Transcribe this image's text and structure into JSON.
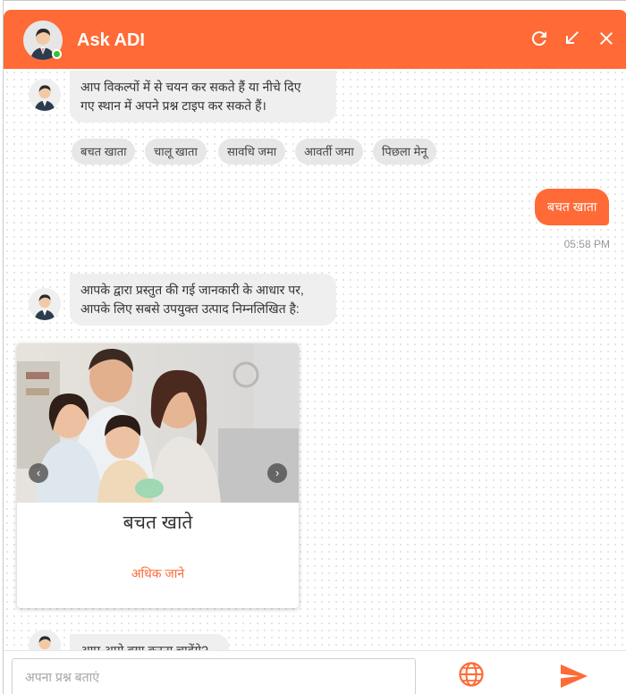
{
  "header": {
    "title": "Ask ADI",
    "icons": [
      "bot-avatar",
      "refresh-icon",
      "minimize-icon",
      "close-icon"
    ]
  },
  "messages": {
    "bot_intro": {
      "line1": "आप विकल्पों में से चयन कर सकते हैं या नीचे दिए",
      "line2": "गए स्थान में अपने प्रश्न टाइप कर सकते हैं।"
    },
    "chips": [
      "बचत खाता",
      "चालू खाता",
      "सावधि जमा",
      "आवर्ती जमा",
      "पिछला मेनू"
    ],
    "user_reply": {
      "text": "बचत खाता",
      "time": "05:58 PM"
    },
    "bot_result": {
      "line1": "आपके द्वारा प्रस्तुत की गई जानकारी के आधार पर,",
      "line2": "आपके लिए सबसे उपयुक्त उत्पाद निम्नलिखित है:"
    },
    "card": {
      "title": "बचत खाते",
      "link": "अधिक जाने"
    },
    "bot_partial": "आप आगे क्या करना चाहेंगे?"
  },
  "footer": {
    "input_placeholder": "अपना प्रश्न बताएं",
    "input_value": ""
  },
  "colors": {
    "accent": "#ff6a36",
    "bubble_bot": "#efefef",
    "chip": "#e7e7e7",
    "online": "#35c23a"
  }
}
